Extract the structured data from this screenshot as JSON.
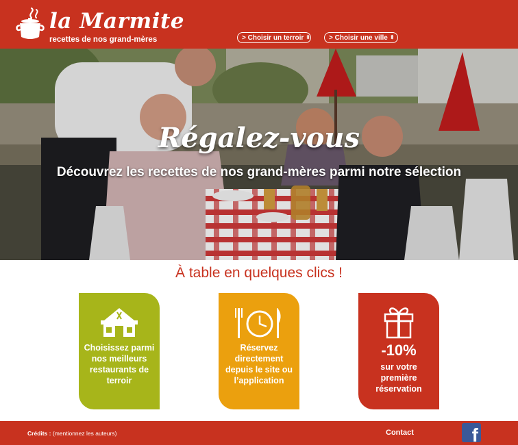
{
  "header": {
    "brand_title": "la Marmite",
    "brand_tagline": "recettes de nos grand-mères",
    "dropdown_terroir": "> Choisir un terroir",
    "dropdown_ville": "> Choisir une ville",
    "colors": {
      "brand_red": "#c8321f"
    }
  },
  "hero": {
    "title": "Régalez-vous",
    "subtitle": "Découvrez les recettes de nos grand-mères parmi notre sélection"
  },
  "section": {
    "title": "À table en quelques clics !"
  },
  "cards": [
    {
      "icon": "restaurant-house-icon",
      "text": "Choisissez parmi nos meilleurs restaurants de terroir",
      "color": "#a7b51a"
    },
    {
      "icon": "plate-clock-cutlery-icon",
      "text": "Réservez directement depuis le site ou l’application",
      "color": "#eba00e"
    },
    {
      "icon": "gift-icon",
      "highlight": "-10%",
      "text": "sur votre première réservation",
      "color": "#c8321f"
    }
  ],
  "footer": {
    "credits_label": "Crédits :",
    "credits_note": "(mentionnez les auteurs)",
    "contact": "Contact",
    "social_icon": "facebook-icon"
  }
}
